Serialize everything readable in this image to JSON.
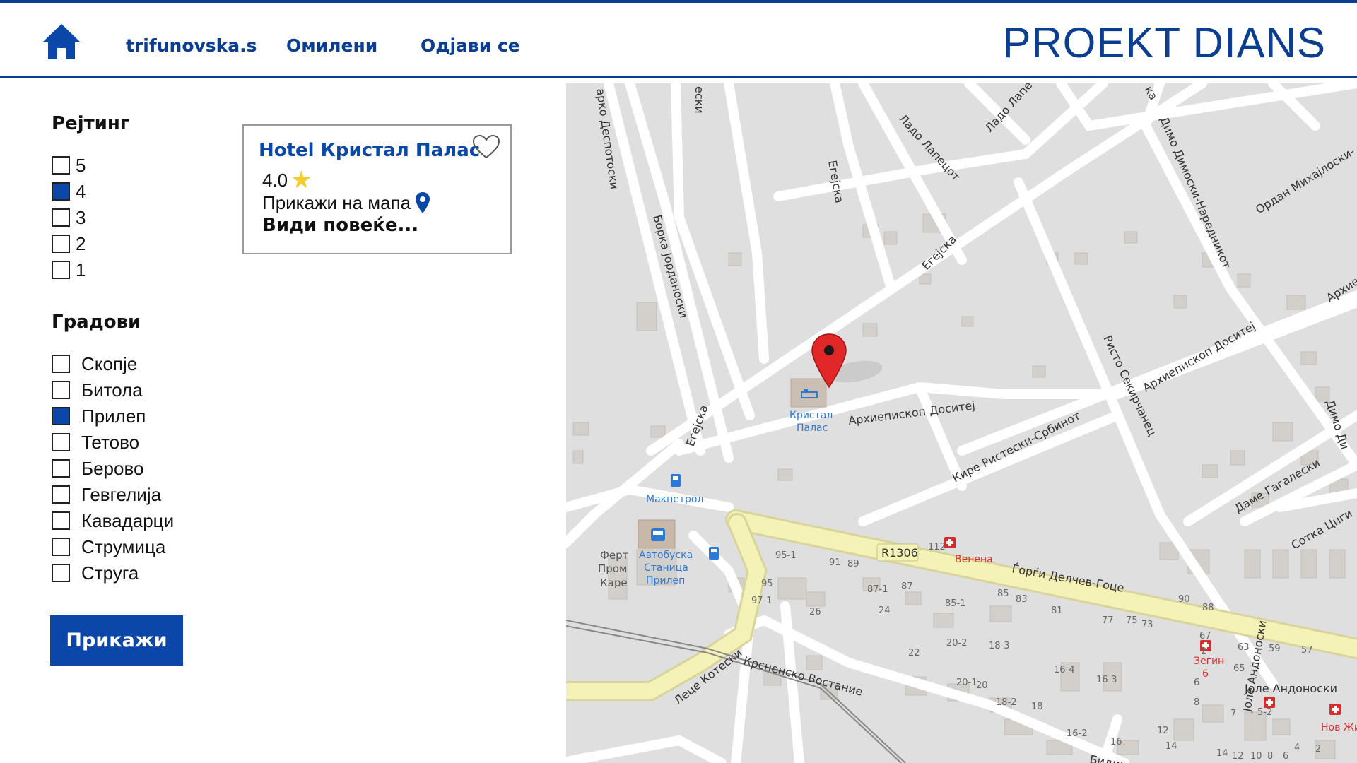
{
  "header": {
    "home_icon": "home-icon",
    "nav": [
      "trifunovska.s",
      "Омилени",
      "Одјави се"
    ],
    "brand": "PROEKT DIANS",
    "accent_color": "#0b3d91"
  },
  "filters": {
    "rating_title": "Рејтинг",
    "ratings": [
      {
        "label": "5",
        "checked": false
      },
      {
        "label": "4",
        "checked": true
      },
      {
        "label": "3",
        "checked": false
      },
      {
        "label": "2",
        "checked": false
      },
      {
        "label": "1",
        "checked": false
      }
    ],
    "cities_title": "Градови",
    "cities": [
      {
        "label": "Скопје",
        "checked": false
      },
      {
        "label": "Битола",
        "checked": false
      },
      {
        "label": "Прилеп",
        "checked": true
      },
      {
        "label": "Тетово",
        "checked": false
      },
      {
        "label": "Берово",
        "checked": false
      },
      {
        "label": "Гевгелија",
        "checked": false
      },
      {
        "label": "Кавадарци",
        "checked": false
      },
      {
        "label": "Струмица",
        "checked": false
      },
      {
        "label": "Струга",
        "checked": false
      }
    ],
    "submit_label": "Прикажи"
  },
  "result": {
    "title": "Hotel Кристал Палас",
    "rating": "4.0",
    "star_icon": "star-icon",
    "map_link": "Прикажи на мапа",
    "pin_icon": "location-pin-icon",
    "more": "Види повеќе...",
    "heart_icon": "heart-outline-icon"
  },
  "map": {
    "labels": {
      "egejska_top": "Егејска",
      "egejska_mid": "Егејска",
      "egejska_low": "Егејска",
      "lado": "Ладо Лапецот",
      "lado2": "Ладо Лапе",
      "dimo": "Димо Димоски-Наредникот",
      "ordan": "Ордан Михајлоски-",
      "borka": "Борка Јорданоски",
      "darko": "арко Деспотоски",
      "eski": "ески",
      "risto": "Ристо Секирчанец",
      "arhiepiskop1": "Архиепископ Доситеј",
      "arhiepiskop2": "Архиепископ Доситеј",
      "arhie": "Архие",
      "kire": "Кире Ристески-Србинот",
      "dame": "Даме Гагалески",
      "sotka": "Сотка Циги",
      "djorgji": "Ѓорѓи Делчев-Гоце",
      "r1306": "R1306",
      "lece": "Леце Котески",
      "kresnensko": "Крсненско Востание",
      "jole": "Јоле Андоноски",
      "jole2": "Јоле Андоноски",
      "bidim": "Бидим",
      "dimo2": "Димо Ди",
      "ka": "ка",
      "kristal": "Кристал",
      "palas": "Палас",
      "makpetrol": "Макпетрол",
      "bus1": "Автобуска",
      "bus2": "Станица",
      "bus3": "Прилеп",
      "fert1": "Ферт",
      "fert2": "Пром",
      "fert3": "Каре",
      "venena": "Венена",
      "zegin1": "Зегин",
      "zegin2": "6",
      "nov_zhivot": "Нов Живо"
    },
    "house_numbers": [
      "95-1",
      "91",
      "89",
      "95",
      "97-1",
      "87-1",
      "87",
      "85-1",
      "85",
      "83",
      "81",
      "77",
      "75",
      "73",
      "67",
      "2",
      "63",
      "59",
      "57",
      "65",
      "26",
      "24",
      "22",
      "20-2",
      "20-1",
      "20",
      "18-3",
      "18-2",
      "18",
      "16-4",
      "16-3",
      "16-2",
      "16",
      "12",
      "14",
      "6",
      "8",
      "7",
      "5-2",
      "4",
      "2",
      "14",
      "12",
      "10",
      "8",
      "6",
      "90",
      "88",
      "112"
    ]
  }
}
